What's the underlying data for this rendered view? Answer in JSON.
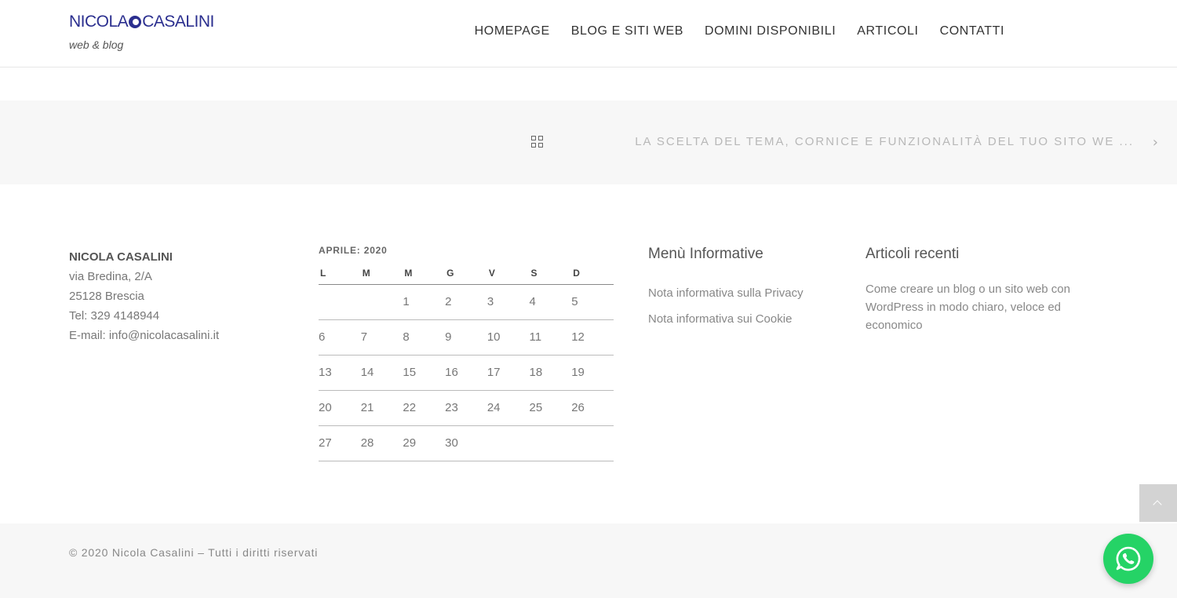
{
  "header": {
    "logo_text_left": "NICOLA",
    "logo_text_right": "CASALINI",
    "tagline": "web & blog",
    "nav": [
      "HOMEPAGE",
      "BLOG E SITI WEB",
      "DOMINI DISPONIBILI",
      "ARTICOLI",
      "CONTATTI"
    ]
  },
  "post_nav": {
    "grid_icon": "grid-icon",
    "next_label": "LA SCELTA DEL TEMA, CORNICE E FUNZIONALITÀ DEL TUO SITO WE ...",
    "next_icon": "chevron-right-icon"
  },
  "contact": {
    "name": "NICOLA CASALINI",
    "street": "via Bredina, 2/A",
    "city": "25128 Brescia",
    "phone": "Tel: 329 4148944",
    "email_prefix": "E-mail: ",
    "email": "info@nicolacasalini.it"
  },
  "calendar": {
    "caption": "APRILE: 2020",
    "weekdays": [
      "L",
      "M",
      "M",
      "G",
      "V",
      "S",
      "D"
    ],
    "weeks": [
      [
        "",
        "",
        "1",
        "2",
        "3",
        "4",
        "5"
      ],
      [
        "6",
        "7",
        "8",
        "9",
        "10",
        "11",
        "12"
      ],
      [
        "13",
        "14",
        "15",
        "16",
        "17",
        "18",
        "19"
      ],
      [
        "20",
        "21",
        "22",
        "23",
        "24",
        "25",
        "26"
      ],
      [
        "27",
        "28",
        "29",
        "30",
        "",
        "",
        ""
      ]
    ]
  },
  "menu_informative": {
    "title": "Menù Informative",
    "links": [
      "Nota informativa sulla Privacy",
      "Nota informativa sui Cookie"
    ]
  },
  "recent_posts": {
    "title": "Articoli recenti",
    "items": [
      "Come creare un blog o un sito web con WordPress in modo chiaro, veloce ed economico"
    ]
  },
  "footer": {
    "copyright": "© 2020 Nicola Casalini – Tutti i diritti riservati"
  },
  "widgets": {
    "scroll_top_icon": "chevron-up-icon",
    "whatsapp_icon": "whatsapp-icon",
    "whatsapp_color": "#25d366"
  }
}
